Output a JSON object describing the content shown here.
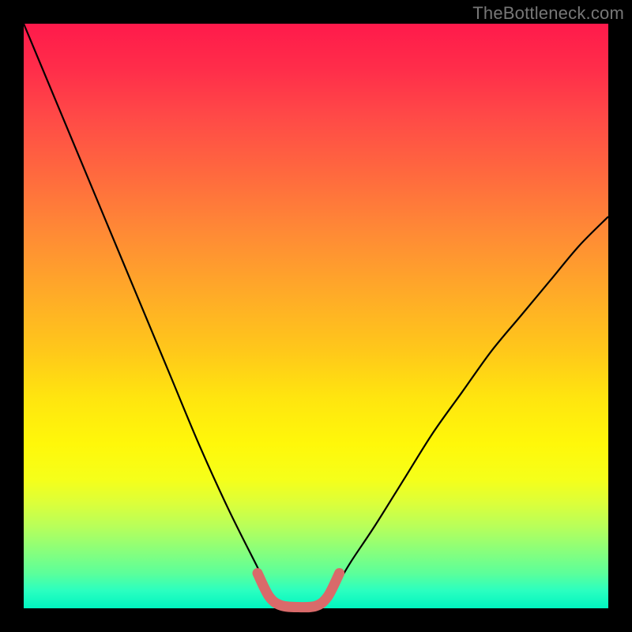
{
  "watermark": "TheBottleneck.com",
  "chart_data": {
    "type": "line",
    "title": "",
    "xlabel": "",
    "ylabel": "",
    "xlim": [
      0,
      100
    ],
    "ylim": [
      0,
      100
    ],
    "series": [
      {
        "name": "left-curve",
        "x": [
          0,
          5,
          10,
          15,
          20,
          25,
          30,
          35,
          40,
          42,
          44
        ],
        "y": [
          100,
          88,
          76,
          64,
          52,
          40,
          28,
          17,
          7,
          3,
          0
        ],
        "color": "#000000"
      },
      {
        "name": "right-curve",
        "x": [
          51,
          53,
          56,
          60,
          65,
          70,
          75,
          80,
          85,
          90,
          95,
          100
        ],
        "y": [
          0,
          3,
          8,
          14,
          22,
          30,
          37,
          44,
          50,
          56,
          62,
          67
        ],
        "color": "#000000"
      },
      {
        "name": "bottom-highlight",
        "x": [
          40,
          42,
          44,
          47,
          50,
          52,
          54
        ],
        "y": [
          6,
          2,
          0.5,
          0.2,
          0.4,
          2,
          6
        ],
        "color": "#d96a6a"
      }
    ],
    "background_gradient": {
      "top": "#ff1a4b",
      "mid": "#ffe50f",
      "bottom": "#00f5c0"
    }
  }
}
